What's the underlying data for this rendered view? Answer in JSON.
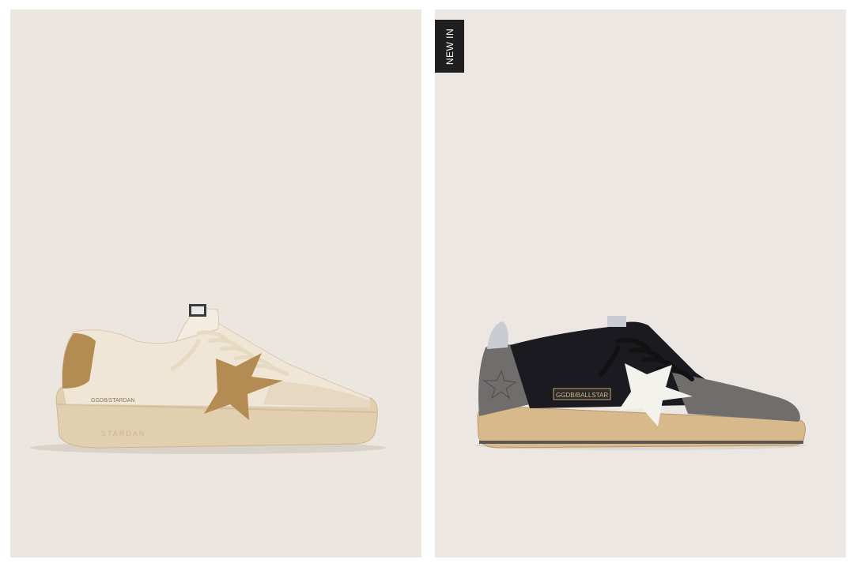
{
  "products": [
    {
      "id": "left",
      "sole_text": "STARDAN",
      "side_logo": "GGDB/STARDAN",
      "colors": {
        "background": "#ebe6e0",
        "upper": "#efe6d6",
        "sole": "#e2cfb0",
        "glitter": "#b48b52"
      }
    },
    {
      "id": "right",
      "badge": "NEW IN",
      "side_logo": "GGDB/BALLSTAR",
      "colors": {
        "background": "#ece7e2",
        "upper": "#1b1a20",
        "suede": "#6f6e6d",
        "sole": "#d7b98c",
        "heel_tab": "#c9ccd0"
      }
    }
  ]
}
